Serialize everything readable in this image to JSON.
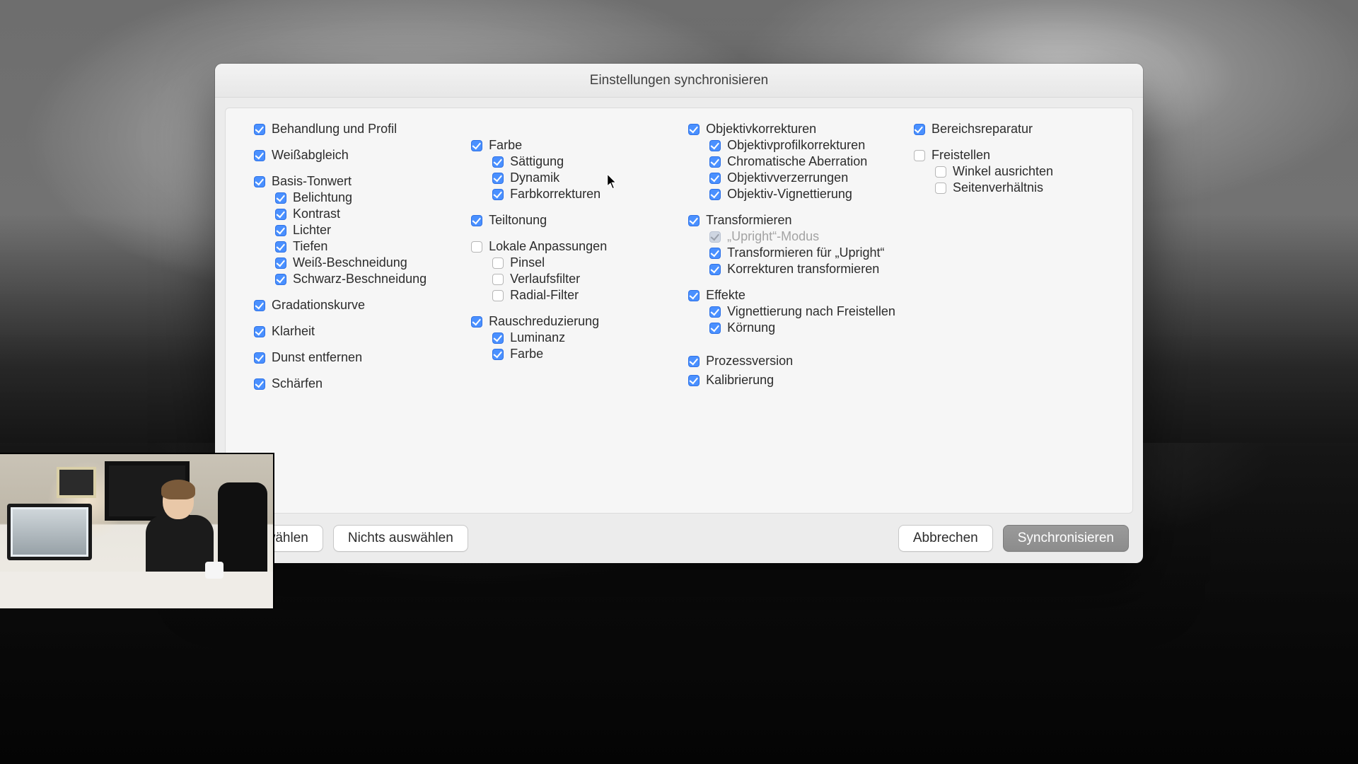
{
  "dialog": {
    "title": "Einstellungen synchronisieren",
    "buttons": {
      "select_all": "auswählen",
      "select_none": "Nichts auswählen",
      "cancel": "Abbrechen",
      "sync": "Synchronisieren"
    }
  },
  "col1": {
    "treatment": {
      "label": "Behandlung und Profil",
      "checked": true
    },
    "whitebalance": {
      "label": "Weißabgleich",
      "checked": true
    },
    "basic": {
      "label": "Basis-Tonwert",
      "checked": true,
      "children": [
        {
          "label": "Belichtung",
          "checked": true
        },
        {
          "label": "Kontrast",
          "checked": true
        },
        {
          "label": "Lichter",
          "checked": true
        },
        {
          "label": "Tiefen",
          "checked": true
        },
        {
          "label": "Weiß-Beschneidung",
          "checked": true
        },
        {
          "label": "Schwarz-Beschneidung",
          "checked": true
        }
      ]
    },
    "tonecurve": {
      "label": "Gradationskurve",
      "checked": true
    },
    "clarity": {
      "label": "Klarheit",
      "checked": true
    },
    "dehaze": {
      "label": "Dunst entfernen",
      "checked": true
    },
    "sharpen": {
      "label": "Schärfen",
      "checked": true
    }
  },
  "col2": {
    "color": {
      "label": "Farbe",
      "checked": true,
      "children": [
        {
          "label": "Sättigung",
          "checked": true
        },
        {
          "label": "Dynamik",
          "checked": true
        },
        {
          "label": "Farbkorrekturen",
          "checked": true
        }
      ]
    },
    "splittoning": {
      "label": "Teiltonung",
      "checked": true
    },
    "local": {
      "label": "Lokale Anpassungen",
      "checked": false,
      "children": [
        {
          "label": "Pinsel",
          "checked": false
        },
        {
          "label": "Verlaufsfilter",
          "checked": false
        },
        {
          "label": "Radial-Filter",
          "checked": false
        }
      ]
    },
    "noise": {
      "label": "Rauschreduzierung",
      "checked": true,
      "children": [
        {
          "label": "Luminanz",
          "checked": true
        },
        {
          "label": "Farbe",
          "checked": true
        }
      ]
    }
  },
  "col3": {
    "lens": {
      "label": "Objektivkorrekturen",
      "checked": true,
      "children": [
        {
          "label": "Objektivprofilkorrekturen",
          "checked": true
        },
        {
          "label": "Chromatische Aberration",
          "checked": true
        },
        {
          "label": "Objektivverzerrungen",
          "checked": true
        },
        {
          "label": "Objektiv-Vignettierung",
          "checked": true
        }
      ]
    },
    "transform": {
      "label": "Transformieren",
      "checked": true,
      "children": [
        {
          "label": "„Upright“-Modus",
          "checked": true,
          "disabled": true
        },
        {
          "label": "Transformieren für „Upright“",
          "checked": true
        },
        {
          "label": "Korrekturen transformieren",
          "checked": true
        }
      ]
    },
    "effects": {
      "label": "Effekte",
      "checked": true,
      "children": [
        {
          "label": "Vignettierung nach Freistellen",
          "checked": true
        },
        {
          "label": "Körnung",
          "checked": true
        }
      ]
    },
    "process": {
      "label": "Prozessversion",
      "checked": true
    },
    "calibration": {
      "label": "Kalibrierung",
      "checked": true
    }
  },
  "col4": {
    "spot": {
      "label": "Bereichsreparatur",
      "checked": true
    },
    "crop": {
      "label": "Freistellen",
      "checked": false,
      "children": [
        {
          "label": "Winkel ausrichten",
          "checked": false
        },
        {
          "label": "Seitenverhältnis",
          "checked": false
        }
      ]
    }
  }
}
